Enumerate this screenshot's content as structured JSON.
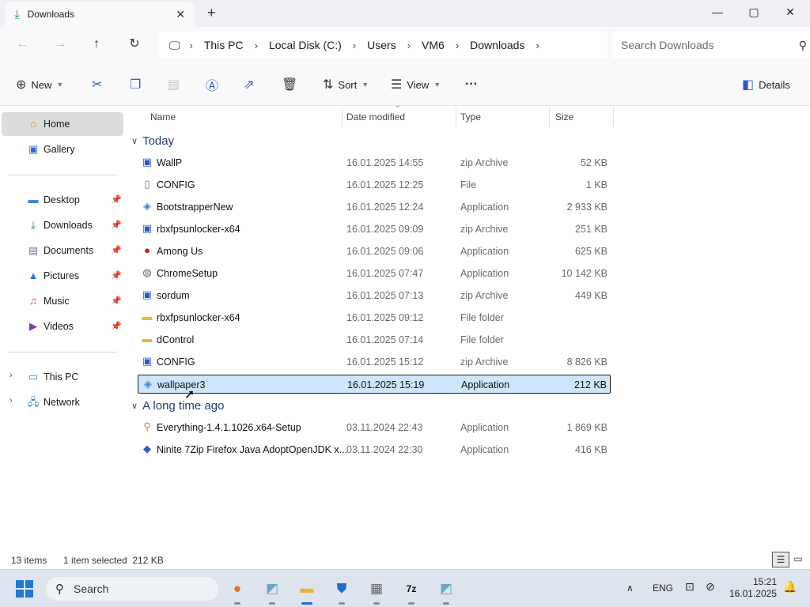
{
  "window": {
    "tab_title": "Downloads",
    "new_tab": "+",
    "close_tab": "✕",
    "minimize": "—",
    "maximize": "▢",
    "close": "✕"
  },
  "address": {
    "crumbs": [
      "This PC",
      "Local Disk (C:)",
      "Users",
      "VM6",
      "Downloads"
    ],
    "search_placeholder": "Search Downloads"
  },
  "commands": {
    "new_label": "New",
    "sort_label": "Sort",
    "view_label": "View",
    "more": "···",
    "details_label": "Details"
  },
  "sidebar": {
    "home": "Home",
    "gallery": "Gallery",
    "desktop": "Desktop",
    "downloads": "Downloads",
    "documents": "Documents",
    "pictures": "Pictures",
    "music": "Music",
    "videos": "Videos",
    "this_pc": "This PC",
    "network": "Network"
  },
  "columns": {
    "name": "Name",
    "date": "Date modified",
    "type": "Type",
    "size": "Size"
  },
  "groups": {
    "today": "Today",
    "long_ago": "A long time ago"
  },
  "files": [
    {
      "name": "WallP",
      "date": "16.01.2025 14:55",
      "type": "zip Archive",
      "size": "52 KB",
      "icon": "zip-icon"
    },
    {
      "name": "CONFIG",
      "date": "16.01.2025 12:25",
      "type": "File",
      "size": "1 KB",
      "icon": "file-icon"
    },
    {
      "name": "BootstrapperNew",
      "date": "16.01.2025 12:24",
      "type": "Application",
      "size": "2 933 KB",
      "icon": "app-icon"
    },
    {
      "name": "rbxfpsunlocker-x64",
      "date": "16.01.2025 09:09",
      "type": "zip Archive",
      "size": "251 KB",
      "icon": "zip-icon"
    },
    {
      "name": "Among Us",
      "date": "16.01.2025 09:06",
      "type": "Application",
      "size": "625 KB",
      "icon": "among-us-icon"
    },
    {
      "name": "ChromeSetup",
      "date": "16.01.2025 07:47",
      "type": "Application",
      "size": "10 142 KB",
      "icon": "setup-icon"
    },
    {
      "name": "sordum",
      "date": "16.01.2025 07:13",
      "type": "zip Archive",
      "size": "449 KB",
      "icon": "zip-icon"
    },
    {
      "name": "rbxfpsunlocker-x64",
      "date": "16.01.2025 09:12",
      "type": "File folder",
      "size": "",
      "icon": "folder-icon"
    },
    {
      "name": "dControl",
      "date": "16.01.2025 07:14",
      "type": "File folder",
      "size": "",
      "icon": "folder-icon"
    },
    {
      "name": "CONFIG",
      "date": "16.01.2025 15:12",
      "type": "zip Archive",
      "size": "8 826 KB",
      "icon": "zip-icon"
    },
    {
      "name": "wallpaper3",
      "date": "16.01.2025 15:19",
      "type": "Application",
      "size": "212 KB",
      "icon": "app-icon",
      "selected": true
    },
    {
      "name": "Everything-1.4.1.1026.x64-Setup",
      "date": "03.11.2024 22:43",
      "type": "Application",
      "size": "1 869 KB",
      "icon": "search-app-icon"
    },
    {
      "name": "Ninite 7Zip Firefox Java AdoptOpenJDK x...",
      "date": "03.11.2024 22:30",
      "type": "Application",
      "size": "416 KB",
      "icon": "ninite-icon"
    }
  ],
  "status": {
    "count": "13 items",
    "selection": "1 item selected  212 KB"
  },
  "taskbar": {
    "search_placeholder": "Search",
    "lang": "ENG",
    "time": "15:21",
    "date": "16.01.2025"
  },
  "colors": {
    "accent": "#1f6fd1",
    "selection": "#cde6fb",
    "group_header": "#1f3f7a"
  }
}
